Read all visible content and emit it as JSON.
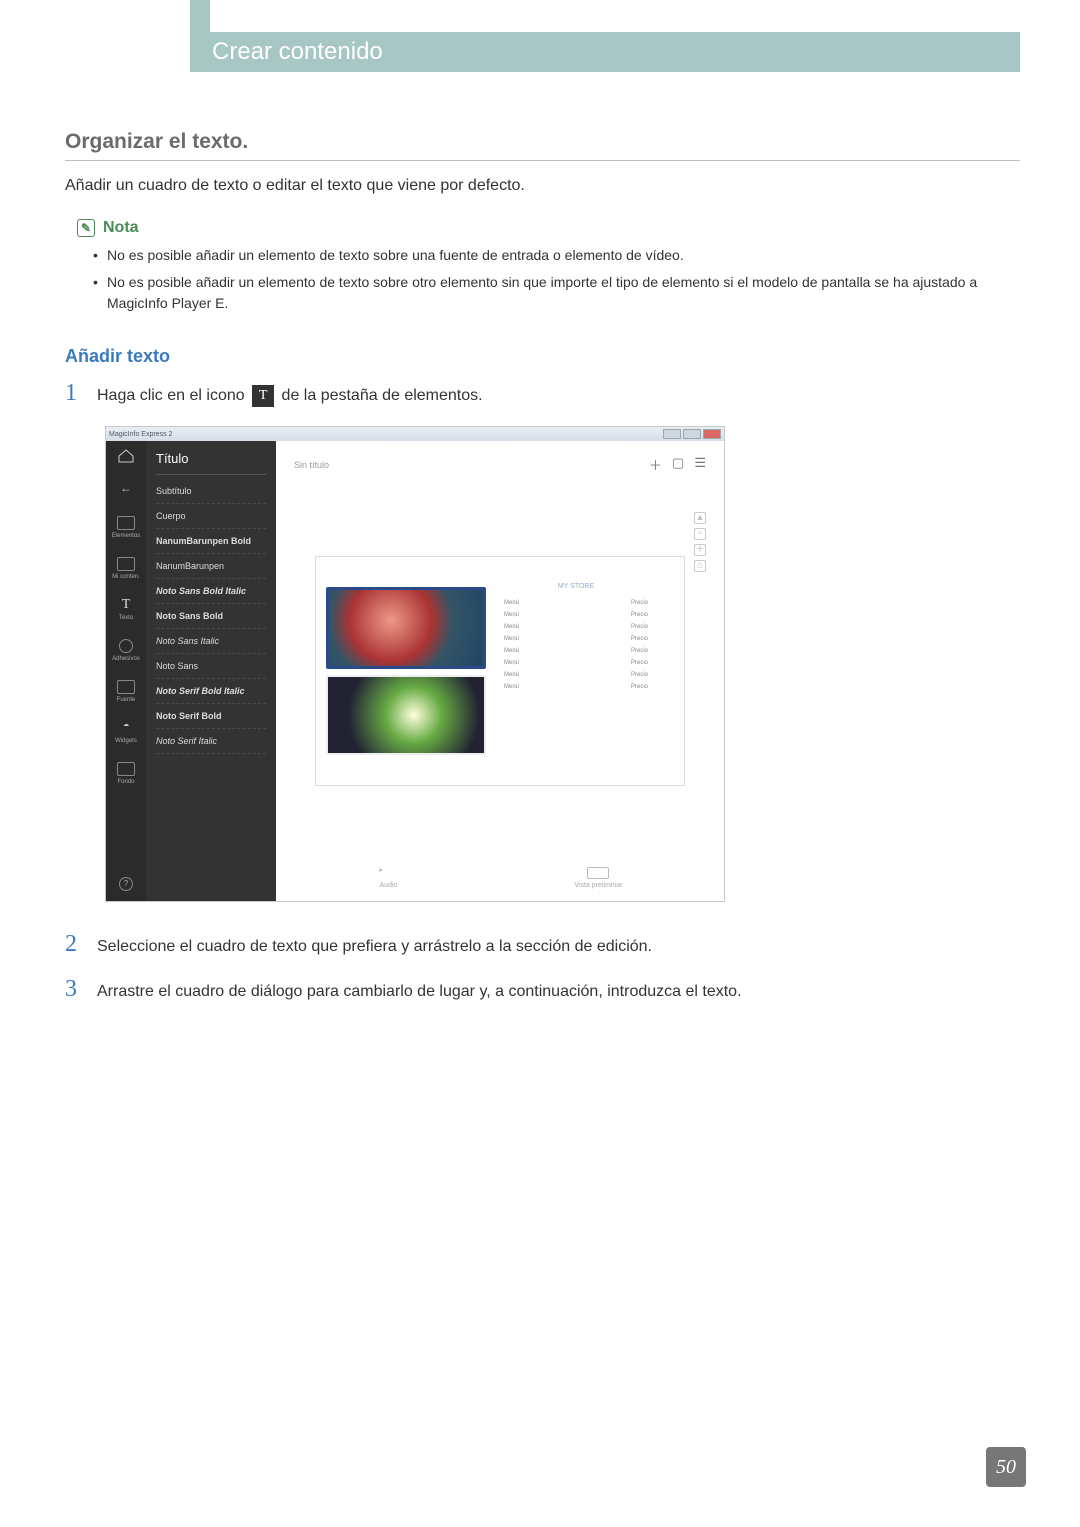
{
  "chapter": {
    "title": "Crear contenido"
  },
  "section": {
    "title": "Organizar el texto.",
    "intro": "Añadir un cuadro de texto o editar el texto que viene por defecto."
  },
  "note": {
    "label": "Nota",
    "items": [
      "No es posible añadir un elemento de texto sobre una fuente de entrada o elemento de vídeo.",
      "No es posible añadir un elemento de texto sobre otro elemento sin que importe el tipo de elemento si el modelo de pantalla se ha ajustado a MagicInfo Player E."
    ]
  },
  "subsection": {
    "title": "Añadir texto"
  },
  "steps": {
    "s1a": "Haga clic en el icono ",
    "s1b": " de la pestaña de elementos.",
    "s2": "Seleccione el cuadro de texto que prefiera y arrástrelo a la sección de edición.",
    "s3": "Arrastre el cuadro de diálogo para cambiarlo de lugar y, a continuación, introduzca el texto."
  },
  "stepNumbers": {
    "n1": "1",
    "n2": "2",
    "n3": "3"
  },
  "inlineIcon": {
    "glyph": "T"
  },
  "app": {
    "windowTitle": "MagicInfo Express 2",
    "rail": {
      "r2": "",
      "r3": "Elementos",
      "r4": "Mi conten.",
      "r5": "Texto",
      "r6": "Adhesivos",
      "r7": "Fuente",
      "r8": "Widgets",
      "r9": "Fondo",
      "help": "?"
    },
    "fontsHeader": "Título",
    "fonts": [
      "Subtítulo",
      "Cuerpo",
      "NanumBarunpen Bold",
      "NanumBarunpen",
      "Noto Sans Bold Italic",
      "Noto Sans Bold",
      "Noto Sans Italic",
      "Noto Sans",
      "Noto Serif Bold Italic",
      "Noto Serif Bold",
      "Noto Serif Italic"
    ],
    "canvas": {
      "docTitle": "Sin título",
      "menuHeader": "MY STORE",
      "menuLabel": "Menú",
      "priceLabel": "Precio"
    },
    "footer": {
      "audio": "Audio",
      "preview": "Vista preliminar"
    }
  },
  "pageNumber": "50"
}
